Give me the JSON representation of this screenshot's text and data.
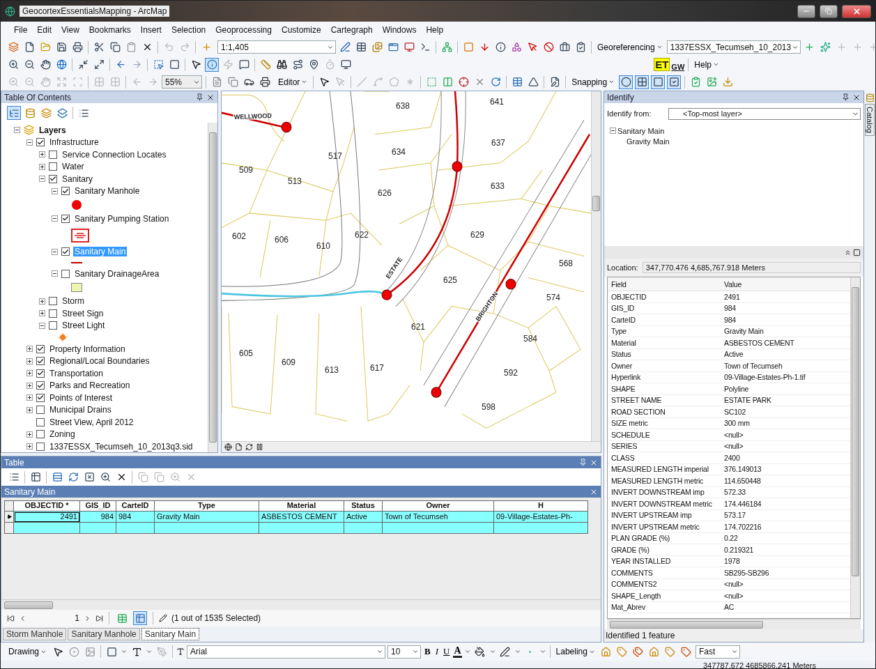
{
  "window": {
    "title": "GeocortexEssentialsMapping - ArcMap"
  },
  "menu": [
    "File",
    "Edit",
    "View",
    "Bookmarks",
    "Insert",
    "Selection",
    "Geoprocessing",
    "Customize",
    "Cartegraph",
    "Windows",
    "Help"
  ],
  "toolbars": {
    "scale": "1:1,405",
    "georeferencing": "Georeferencing",
    "raster_layer": "1337ESSX_Tecumseh_10_2013",
    "logo": [
      "ET",
      "GW"
    ],
    "help": "Help",
    "layout_zoom": "55%",
    "editor": "Editor",
    "snapping": "Snapping"
  },
  "toc": {
    "title": "Table Of Contents",
    "root": "Layers",
    "layers": [
      {
        "label": "Infrastructure",
        "expandable": true,
        "expanded": true,
        "checked": true,
        "selected": false,
        "children": [
          {
            "label": "Service Connection Locates",
            "expandable": true,
            "expanded": false,
            "checked": false,
            "selected": false
          },
          {
            "label": "Water",
            "expandable": true,
            "expanded": false,
            "checked": false,
            "selected": false
          },
          {
            "label": "Sanitary",
            "expandable": true,
            "expanded": true,
            "checked": true,
            "selected": false,
            "children": [
              {
                "label": "Sanitary Manhole",
                "expandable": true,
                "expanded": true,
                "checked": true,
                "selected": false,
                "legend": {
                  "kind": "dot"
                }
              },
              {
                "label": "Sanitary Pumping Station",
                "expandable": true,
                "expanded": true,
                "checked": true,
                "selected": false,
                "legend": {
                  "kind": "pump"
                }
              },
              {
                "label": "Sanitary Main",
                "expandable": true,
                "expanded": true,
                "checked": true,
                "selected": true,
                "legend": {
                  "kind": "line"
                }
              },
              {
                "label": "Sanitary DrainageArea",
                "expandable": true,
                "expanded": true,
                "checked": false,
                "selected": false,
                "legend": {
                  "kind": "fill"
                }
              }
            ]
          },
          {
            "label": "Storm",
            "expandable": true,
            "expanded": false,
            "checked": false,
            "selected": false
          },
          {
            "label": "Street Sign",
            "expandable": true,
            "expanded": false,
            "checked": false,
            "selected": false
          },
          {
            "label": "Street Light",
            "expandable": true,
            "expanded": true,
            "checked": false,
            "selected": false,
            "legend": {
              "kind": "light"
            }
          }
        ]
      },
      {
        "label": "Property Information",
        "expandable": true,
        "expanded": false,
        "checked": true,
        "selected": false
      },
      {
        "label": "Regional/Local Boundaries",
        "expandable": true,
        "expanded": false,
        "checked": true,
        "selected": false
      },
      {
        "label": "Transportation",
        "expandable": true,
        "expanded": false,
        "checked": true,
        "selected": false
      },
      {
        "label": "Parks and Recreation",
        "expandable": true,
        "expanded": false,
        "checked": true,
        "selected": false
      },
      {
        "label": "Points of Interest",
        "expandable": true,
        "expanded": false,
        "checked": true,
        "selected": false
      },
      {
        "label": "Municipal Drains",
        "expandable": true,
        "expanded": false,
        "checked": false,
        "selected": false
      },
      {
        "label": "Street View, April 2012",
        "expandable": false,
        "checked": false,
        "selected": false
      },
      {
        "label": "Zoning",
        "expandable": true,
        "expanded": false,
        "checked": false,
        "selected": false
      },
      {
        "label": "1337ESSX_Tecumseh_10_2013q3.sid",
        "expandable": true,
        "expanded": false,
        "checked": false,
        "selected": false
      }
    ]
  },
  "map": {
    "parcels": [
      "638",
      "641",
      "517",
      "634",
      "637",
      "509",
      "513",
      "626",
      "633",
      "602",
      "606",
      "610",
      "622",
      "629",
      "568",
      "625",
      "574",
      "621",
      "584",
      "605",
      "609",
      "613",
      "617",
      "592",
      "598"
    ],
    "streets": [
      "WELLWOOD",
      "ESTATE",
      "BRIGHTON"
    ]
  },
  "identify": {
    "title": "Identify",
    "from_label": "Identify from:",
    "from_value": "<Top-most layer>",
    "tree": {
      "label": "Sanitary Main",
      "children": [
        {
          "label": "Gravity Main"
        }
      ]
    },
    "location_label": "Location:",
    "location": "347,770.476  4,685,767.918 Meters",
    "field_header": "Field",
    "value_header": "Value",
    "attributes": [
      {
        "field": "OBJECTID",
        "value": "2491"
      },
      {
        "field": "GIS_ID",
        "value": "984"
      },
      {
        "field": "CarteID",
        "value": "984"
      },
      {
        "field": "Type",
        "value": "Gravity Main"
      },
      {
        "field": "Material",
        "value": "ASBESTOS CEMENT"
      },
      {
        "field": "Status",
        "value": "Active"
      },
      {
        "field": "Owner",
        "value": "Town of Tecumseh"
      },
      {
        "field": "Hyperlink",
        "value": "09-Village-Estates-Ph-1.tif"
      },
      {
        "field": "SHAPE",
        "value": "Polyline"
      },
      {
        "field": "STREET NAME",
        "value": "ESTATE PARK"
      },
      {
        "field": "ROAD SECTION",
        "value": "SC102"
      },
      {
        "field": "SIZE metric",
        "value": "300 mm"
      },
      {
        "field": "SCHEDULE",
        "value": "<null>"
      },
      {
        "field": "SERIES",
        "value": "<null>"
      },
      {
        "field": "CLASS",
        "value": "2400"
      },
      {
        "field": "MEASURED LENGTH imperial",
        "value": "376.149013"
      },
      {
        "field": "MEASURED LENGTH metric",
        "value": "114.650448"
      },
      {
        "field": "INVERT DOWNSTREAM imp",
        "value": "572.33"
      },
      {
        "field": "INVERT DOWNSTREAM metric",
        "value": "174.446184"
      },
      {
        "field": "INVERT UPSTREAM imp",
        "value": "573.17"
      },
      {
        "field": "INVERT UPSTREAM metric",
        "value": "174.702216"
      },
      {
        "field": "PLAN GRADE (%)",
        "value": "0.22"
      },
      {
        "field": "GRADE (%)",
        "value": "0.219321"
      },
      {
        "field": "YEAR INSTALLED",
        "value": "1978"
      },
      {
        "field": "COMMENTS",
        "value": "SB295-SB296"
      },
      {
        "field": "COMMENTS2",
        "value": "<null>"
      },
      {
        "field": "SHAPE_Length",
        "value": "<null>"
      },
      {
        "field": "Mat_Abrev",
        "value": "AC"
      }
    ],
    "status": "Identified 1 feature"
  },
  "catalog_tab": "Catalog",
  "table": {
    "title": "Table",
    "layer": "Sanitary Main",
    "columns": [
      "OBJECTID *",
      "GIS_ID",
      "CarteID",
      "Type",
      "Material",
      "Status",
      "Owner",
      "H"
    ],
    "rows": [
      {
        "selected": true,
        "cells": [
          "2491",
          "984",
          "984",
          "Gravity Main",
          "ASBESTOS CEMENT",
          "Active",
          "Town of Tecumseh",
          "09-Village-Estates-Ph-"
        ]
      }
    ],
    "record": "1",
    "selection": "(1 out of 1535 Selected)",
    "tabs": [
      {
        "label": "Storm Manhole",
        "selected": false
      },
      {
        "label": "Sanitary Manhole",
        "selected": false
      },
      {
        "label": "Sanitary Main",
        "selected": true
      }
    ]
  },
  "drawing": {
    "menu": "Drawing",
    "font": "Arial",
    "size": "10",
    "bold": "B",
    "italic": "I",
    "underline": "U",
    "font_color": "A",
    "labeling": "Labeling",
    "quality": "Fast"
  },
  "status_bar": "347787.672  4685866.241 Meters"
}
